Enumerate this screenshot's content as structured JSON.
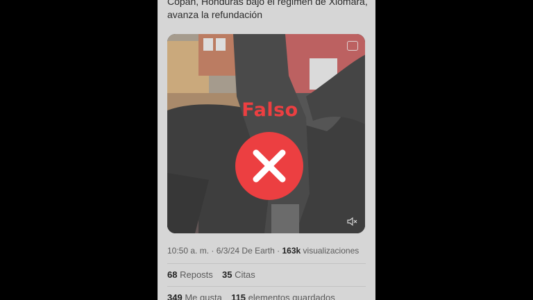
{
  "post": {
    "text_line1": "Copán, Honduras bajo el régimen de Xiomara,",
    "text_line2": "avanza la refundación",
    "time": "10:50 a. m.",
    "date_source": "6/3/24 De Earth",
    "views_count": "163k",
    "views_label": "visualizaciones",
    "reposts_count": "68",
    "reposts_label": "Reposts",
    "quotes_count": "35",
    "quotes_label": "Citas",
    "likes_count": "349",
    "likes_label": "Me gusta",
    "bookmarks_count": "115",
    "bookmarks_label": "elementos guardados"
  },
  "verdict": {
    "label": "Falso",
    "color": "#ec3f41",
    "icon": "x-mark-icon"
  },
  "media": {
    "badge_icon": "content-badge-icon",
    "mute_icon": "speaker-muted-icon"
  },
  "colors": {
    "background": "#000000",
    "panel": "#d6d6d6"
  }
}
